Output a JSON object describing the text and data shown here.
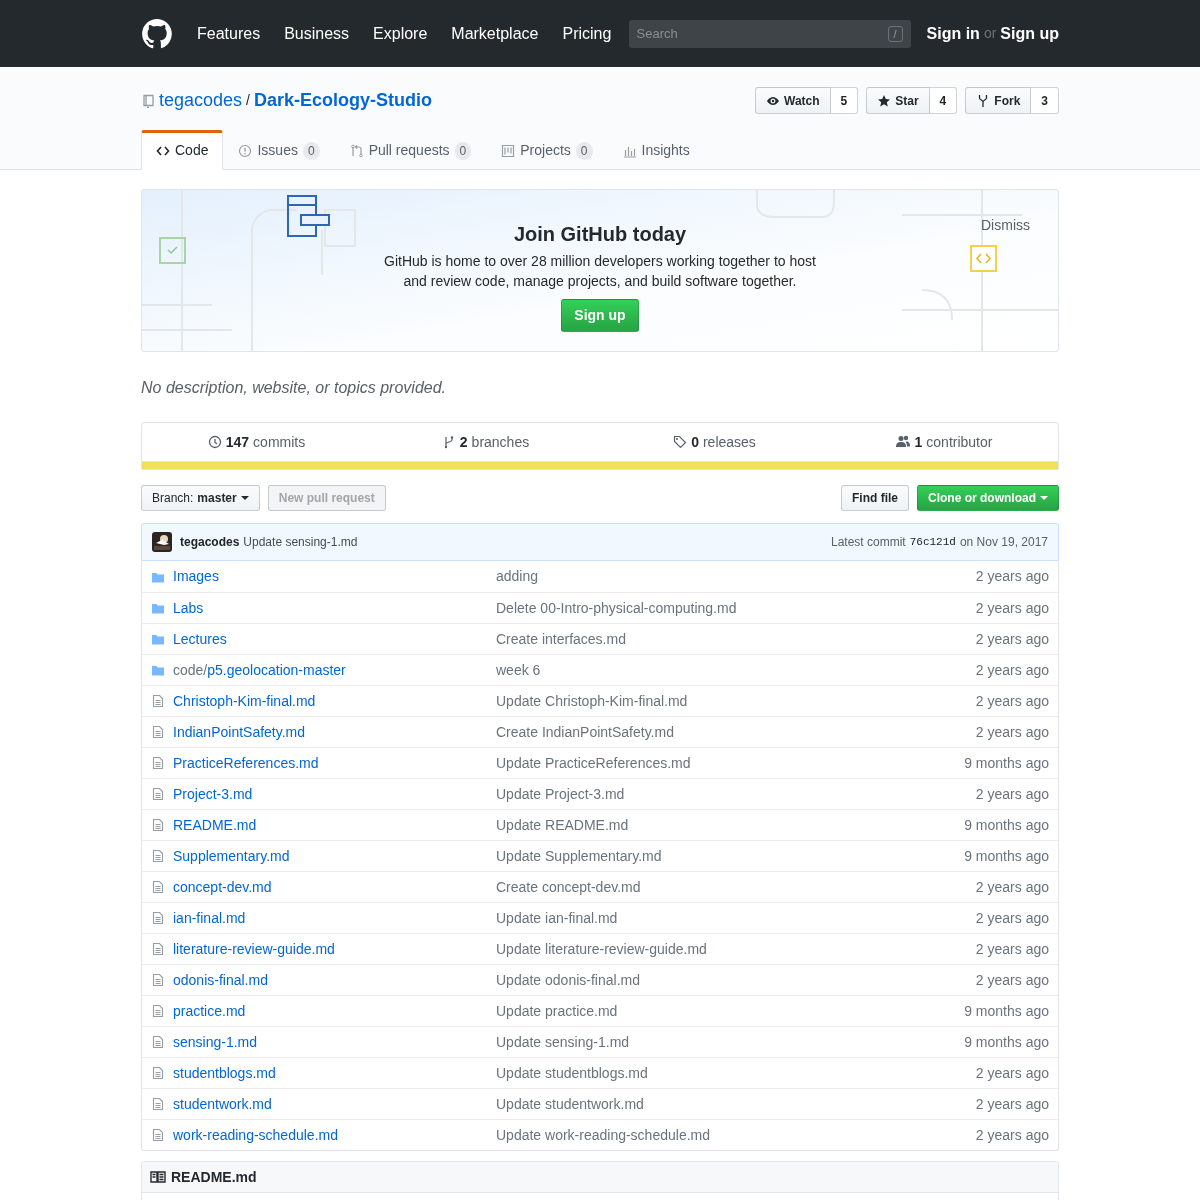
{
  "header": {
    "nav": [
      "Features",
      "Business",
      "Explore",
      "Marketplace",
      "Pricing"
    ],
    "search": {
      "placeholder": "Search",
      "key": "/"
    },
    "sign_in": "Sign in",
    "or": "or",
    "sign_up": "Sign up"
  },
  "repo": {
    "owner": "tegacodes",
    "separator": "/",
    "name": "Dark-Ecology-Studio"
  },
  "actions": [
    {
      "kind": "watch",
      "label": "Watch",
      "count": "5"
    },
    {
      "kind": "star",
      "label": "Star",
      "count": "4"
    },
    {
      "kind": "fork",
      "label": "Fork",
      "count": "3"
    }
  ],
  "tabs": [
    {
      "kind": "code",
      "label": "Code",
      "selected": true
    },
    {
      "kind": "issues",
      "label": "Issues",
      "count": "0",
      "selected": false
    },
    {
      "kind": "pulls",
      "label": "Pull requests",
      "count": "0",
      "selected": false
    },
    {
      "kind": "projects",
      "label": "Projects",
      "count": "0",
      "selected": false
    },
    {
      "kind": "insights",
      "label": "Insights",
      "selected": false
    }
  ],
  "signup_banner": {
    "title": "Join GitHub today",
    "text": "GitHub is home to over 28 million developers working together to host and review code, manage projects, and build software together.",
    "button": "Sign up",
    "dismiss": "Dismiss"
  },
  "description": "No description, website, or topics provided.",
  "summary": [
    {
      "kind": "commits",
      "number": "147",
      "label": "commits"
    },
    {
      "kind": "branches",
      "number": "2",
      "label": "branches"
    },
    {
      "kind": "releases",
      "number": "0",
      "label": "releases"
    },
    {
      "kind": "contributors",
      "number": "1",
      "label": "contributor"
    }
  ],
  "language_bar": [
    {
      "color": "#f1e05a",
      "level": 1
    }
  ],
  "branch": {
    "label": "Branch:",
    "name": "master"
  },
  "new_pull_request": {
    "label": "New pull request",
    "disabled": true
  },
  "find_file": "Find file",
  "clone": "Clone or download",
  "latest_commit": {
    "author": "tegacodes",
    "message": "Update sensing-1.md",
    "prefix": "Latest commit",
    "sha": "76c121d",
    "date": "on Nov 19, 2017"
  },
  "files": [
    {
      "kind": "dir",
      "name": "Images",
      "message": "adding",
      "age": "2 years ago"
    },
    {
      "kind": "dir",
      "name": "Labs",
      "message": "Delete 00-Intro-physical-computing.md",
      "age": "2 years ago"
    },
    {
      "kind": "dir",
      "name": "Lectures",
      "message": "Create interfaces.md",
      "age": "2 years ago"
    },
    {
      "kind": "dir",
      "prefix": "code/",
      "name": "p5.geolocation-master",
      "message": "week 6",
      "age": "2 years ago"
    },
    {
      "kind": "file",
      "name": "Christoph-Kim-final.md",
      "message": "Update Christoph-Kim-final.md",
      "age": "2 years ago"
    },
    {
      "kind": "file",
      "name": "IndianPointSafety.md",
      "message": "Create IndianPointSafety.md",
      "age": "2 years ago"
    },
    {
      "kind": "file",
      "name": "PracticeReferences.md",
      "message": "Update PracticeReferences.md",
      "age": "9 months ago"
    },
    {
      "kind": "file",
      "name": "Project-3.md",
      "message": "Update Project-3.md",
      "age": "2 years ago"
    },
    {
      "kind": "file",
      "name": "README.md",
      "message": "Update README.md",
      "age": "9 months ago"
    },
    {
      "kind": "file",
      "name": "Supplementary.md",
      "message": "Update Supplementary.md",
      "age": "9 months ago"
    },
    {
      "kind": "file",
      "name": "concept-dev.md",
      "message": "Create concept-dev.md",
      "age": "2 years ago"
    },
    {
      "kind": "file",
      "name": "ian-final.md",
      "message": "Update ian-final.md",
      "age": "2 years ago"
    },
    {
      "kind": "file",
      "name": "literature-review-guide.md",
      "message": "Update literature-review-guide.md",
      "age": "2 years ago"
    },
    {
      "kind": "file",
      "name": "odonis-final.md",
      "message": "Update odonis-final.md",
      "age": "2 years ago"
    },
    {
      "kind": "file",
      "name": "practice.md",
      "message": "Update practice.md",
      "age": "9 months ago"
    },
    {
      "kind": "file",
      "name": "sensing-1.md",
      "message": "Update sensing-1.md",
      "age": "9 months ago"
    },
    {
      "kind": "file",
      "name": "studentblogs.md",
      "message": "Update studentblogs.md",
      "age": "2 years ago"
    },
    {
      "kind": "file",
      "name": "studentwork.md",
      "message": "Update studentwork.md",
      "age": "2 years ago"
    },
    {
      "kind": "file",
      "name": "work-reading-schedule.md",
      "message": "Update work-reading-schedule.md",
      "age": "2 years ago"
    }
  ],
  "readme": {
    "title": "README.md"
  }
}
